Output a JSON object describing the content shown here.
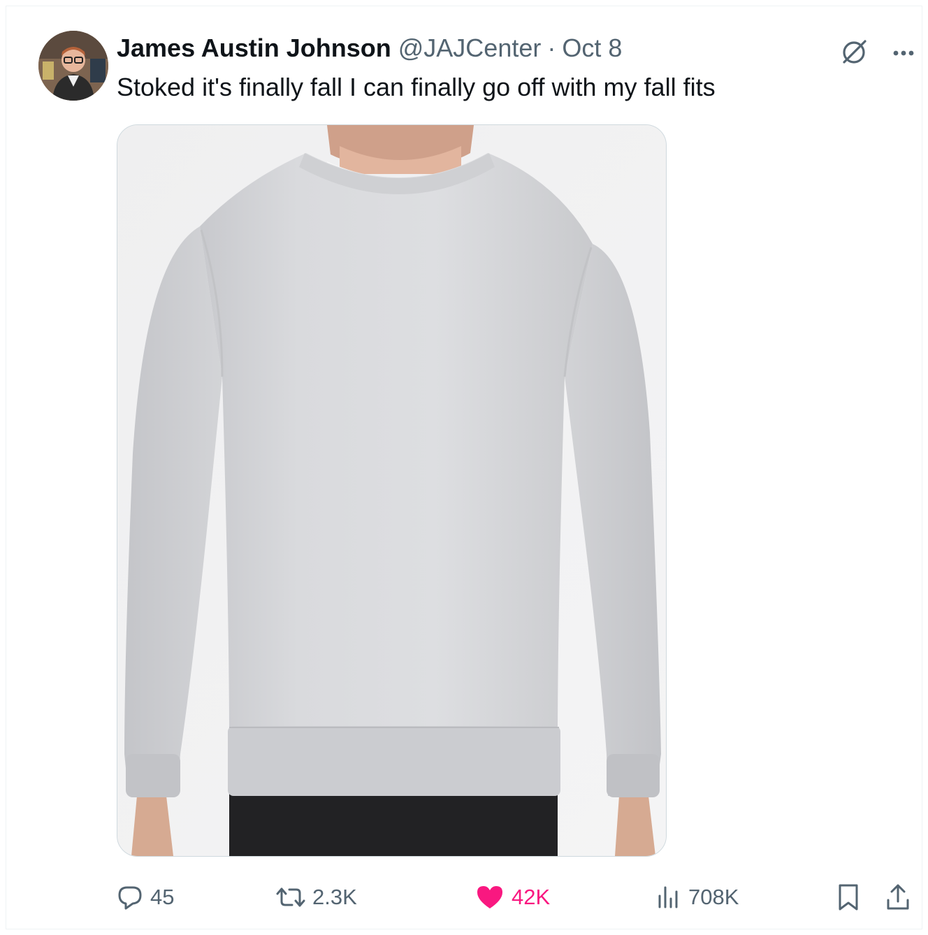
{
  "tweet": {
    "author": {
      "display_name": "James Austin Johnson",
      "handle": "@JAJCenter"
    },
    "separator": "·",
    "date": "Oct 8",
    "text": "Stoked it's finally fall I can finally go off with my fall fits",
    "media": {
      "kind": "photo",
      "subject": "gray crewneck sweatshirt"
    },
    "metrics": {
      "replies": "45",
      "reposts": "2.3K",
      "likes": "42K",
      "views": "708K"
    },
    "liked": true
  },
  "colors": {
    "text_primary": "#0f1419",
    "text_secondary": "#536471",
    "like_pink": "#f91880",
    "border": "#eff3f4"
  },
  "icons": {
    "header": [
      "grok-icon",
      "more-icon"
    ],
    "actions": [
      "reply-icon",
      "repost-icon",
      "like-icon",
      "views-icon",
      "bookmark-icon",
      "share-icon"
    ]
  }
}
